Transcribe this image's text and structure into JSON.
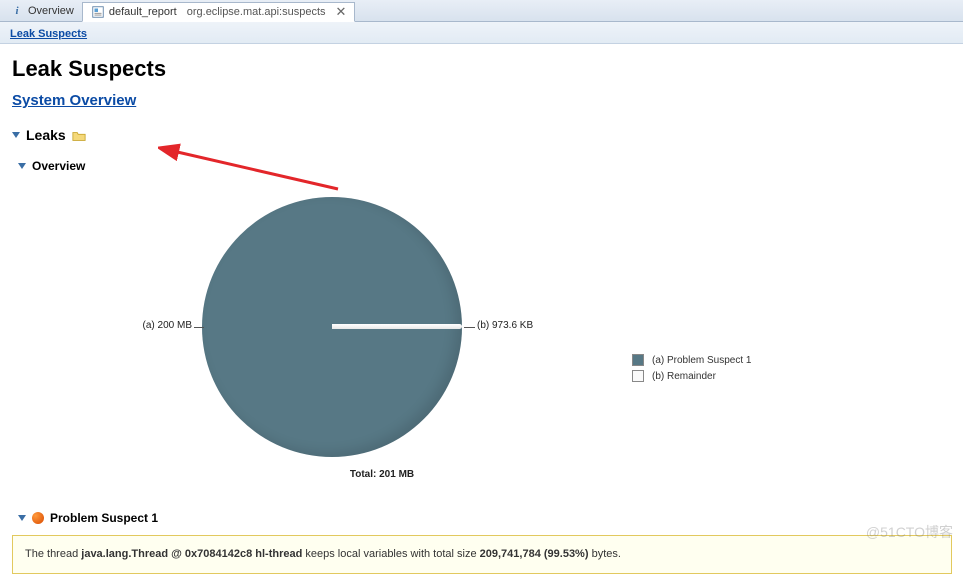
{
  "tabs": {
    "overview": "Overview",
    "report_prefix": "default_report",
    "report_suffix": "org.eclipse.mat.api:suspects"
  },
  "subnav": {
    "leak_suspects": "Leak Suspects"
  },
  "page_title": "Leak Suspects",
  "system_overview_link": "System Overview",
  "sections": {
    "leaks": "Leaks",
    "overview": "Overview",
    "problem_suspect_1": "Problem Suspect 1"
  },
  "chart_data": {
    "type": "pie",
    "title": "",
    "total_label": "Total: 201 MB",
    "series": [
      {
        "name": "(a)  Problem Suspect 1",
        "value_label": "(a)  200 MB",
        "value_mb": 200,
        "color": "#577885"
      },
      {
        "name": "(b)  Remainder",
        "value_label": "(b)  973.6 KB",
        "value_kb": 973.6,
        "color": "#fafafa"
      }
    ]
  },
  "suspect_box": {
    "prefix": "The thread ",
    "thread": "java.lang.Thread @ 0x7084142c8 hl-thread",
    "mid": " keeps local variables with total size ",
    "size": "209,741,784 (99.53%)",
    "suffix": " bytes."
  },
  "watermark": "@51CTO博客"
}
